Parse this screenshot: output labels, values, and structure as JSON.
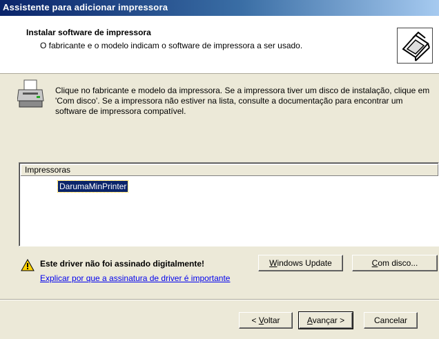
{
  "window": {
    "title": "Assistente para adicionar impressora"
  },
  "header": {
    "title": "Instalar software de impressora",
    "subtitle": "O fabricante e o modelo indicam o software de impressora a ser usado."
  },
  "instructions": {
    "text": "Clique no fabricante e modelo da impressora. Se a impressora tiver um disco de instalação, clique em 'Com disco'. Se a impressora não estiver na lista, consulte a documentação para encontrar um software de impressora compatível."
  },
  "printers_list": {
    "column_header": "Impressoras",
    "items": [
      {
        "label": "DarumaMinPrinter",
        "selected": true
      }
    ]
  },
  "driver_warning": {
    "message": "Este driver não foi assinado digitalmente!",
    "link": "Explicar por que a assinatura de driver é importante"
  },
  "buttons": {
    "windows_update": {
      "mnemonic": "W",
      "rest": "indows Update"
    },
    "have_disk": {
      "mnemonic": "C",
      "rest": "om disco..."
    },
    "back": {
      "prefix": "< ",
      "mnemonic": "V",
      "rest": "oltar"
    },
    "next": {
      "mnemonic": "A",
      "rest": "vançar >"
    },
    "cancel": "Cancelar"
  },
  "icons": {
    "header": "printer-install-icon",
    "instructions": "printer-icon",
    "warning": "warning-triangle-icon"
  },
  "colors": {
    "titlebar_start": "#0a246a",
    "titlebar_end": "#a6caf0",
    "dialog_bg": "#ece9d8",
    "selection_bg": "#0a246a",
    "link": "#0000ee",
    "warning": "#ffd200"
  }
}
